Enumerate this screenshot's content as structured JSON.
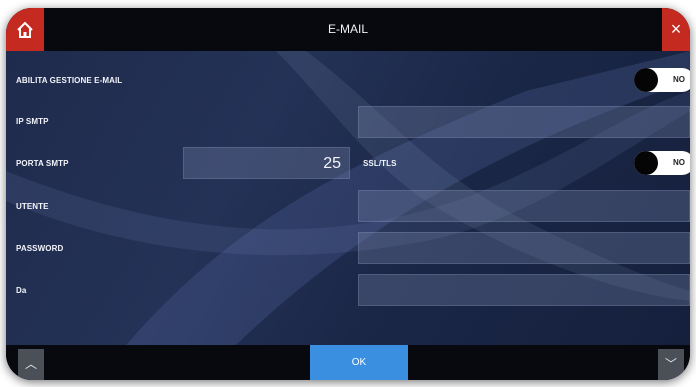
{
  "window": {
    "title": "E-MAIL",
    "close_glyph": "×"
  },
  "icons": {
    "home": "home-icon",
    "close": "close-icon",
    "up": "chevron-up-icon",
    "down": "chevron-down-icon"
  },
  "form": {
    "enable_label": "ABILITA GESTIONE E-MAIL",
    "enable_toggle": "NO",
    "ip_label": "IP SMTP",
    "ip_value": "",
    "port_label": "PORTA SMTP",
    "port_value": "25",
    "ssl_label": "SSL/TLS",
    "ssl_toggle": "NO",
    "user_label": "UTENTE",
    "user_value": "",
    "password_label": "PASSWORD",
    "password_value": "",
    "from_label": "Da",
    "from_value": ""
  },
  "footer": {
    "ok_label": "OK",
    "up_glyph": "︿",
    "down_glyph": "﹀"
  },
  "colors": {
    "accent_red": "#c42a20",
    "ok_blue": "#3b8fe0",
    "bar_black": "#07090f"
  }
}
